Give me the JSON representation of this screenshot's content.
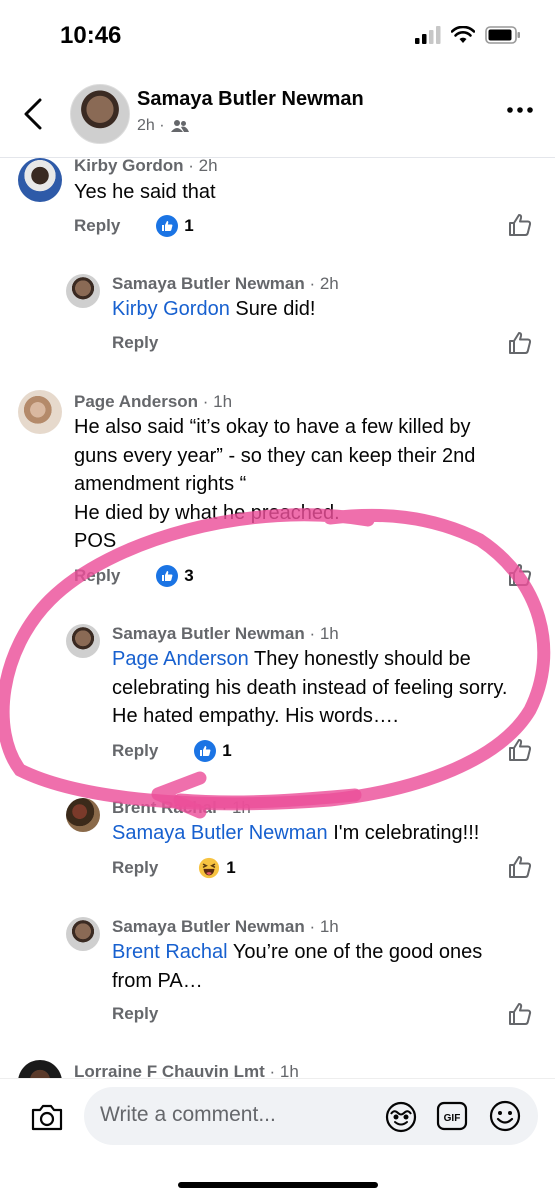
{
  "status_bar": {
    "time": "10:46"
  },
  "header": {
    "name": "Samaya Butler Newman",
    "meta": "2h ·"
  },
  "comments": [
    {
      "author": "Kirby Gordon",
      "time": " · 2h",
      "mention": "",
      "text": "Yes he said that",
      "reply": "Reply",
      "reaction": "like",
      "count": "1"
    },
    {
      "author": "Samaya Butler Newman",
      "time": " · 2h",
      "mention": "Kirby Gordon",
      "text": " Sure did!",
      "reply": "Reply",
      "reaction": "",
      "count": ""
    },
    {
      "author": "Page Anderson",
      "time": " · 1h",
      "mention": "",
      "text": "He also said “it’s okay to have a few killed by guns every year” - so they can keep their 2nd amendment rights “\nHe died by what he preached.\nPOS",
      "reply": "Reply",
      "reaction": "like",
      "count": "3"
    },
    {
      "author": "Samaya Butler Newman",
      "time": " · 1h",
      "mention": "Page Anderson",
      "text": " They honestly should be celebrating his death instead of feeling sorry.  He hated empathy.  His words….",
      "reply": "Reply",
      "reaction": "like",
      "count": "1"
    },
    {
      "author": "Brent Rachal",
      "time": " · 1h",
      "mention": "Samaya Butler Newman",
      "text": " I'm celebrating!!!",
      "reply": "Reply",
      "reaction": "haha",
      "count": "1"
    },
    {
      "author": "Samaya Butler Newman",
      "time": " · 1h",
      "mention": "Brent Rachal",
      "text": " You’re one of the good ones from PA…",
      "reply": "Reply",
      "reaction": "",
      "count": ""
    },
    {
      "author": "Lorraine F Chauvin Lmt",
      "time": " · 1h",
      "mention": "",
      "text": "",
      "reply": "",
      "reaction": "",
      "count": ""
    }
  ],
  "composer": {
    "placeholder": "Write a comment..."
  },
  "colors": {
    "mention": "#1760cf",
    "like_blue": "#1b74e4",
    "annotation_pink": "#ec4f9a",
    "meta_gray": "#65676b"
  },
  "icons": [
    "back-arrow-icon",
    "friends-icon",
    "more-icon",
    "like-icon",
    "thumbs-up-icon",
    "haha-icon",
    "camera-icon",
    "sticker-icon",
    "gif-icon",
    "emoji-icon"
  ]
}
